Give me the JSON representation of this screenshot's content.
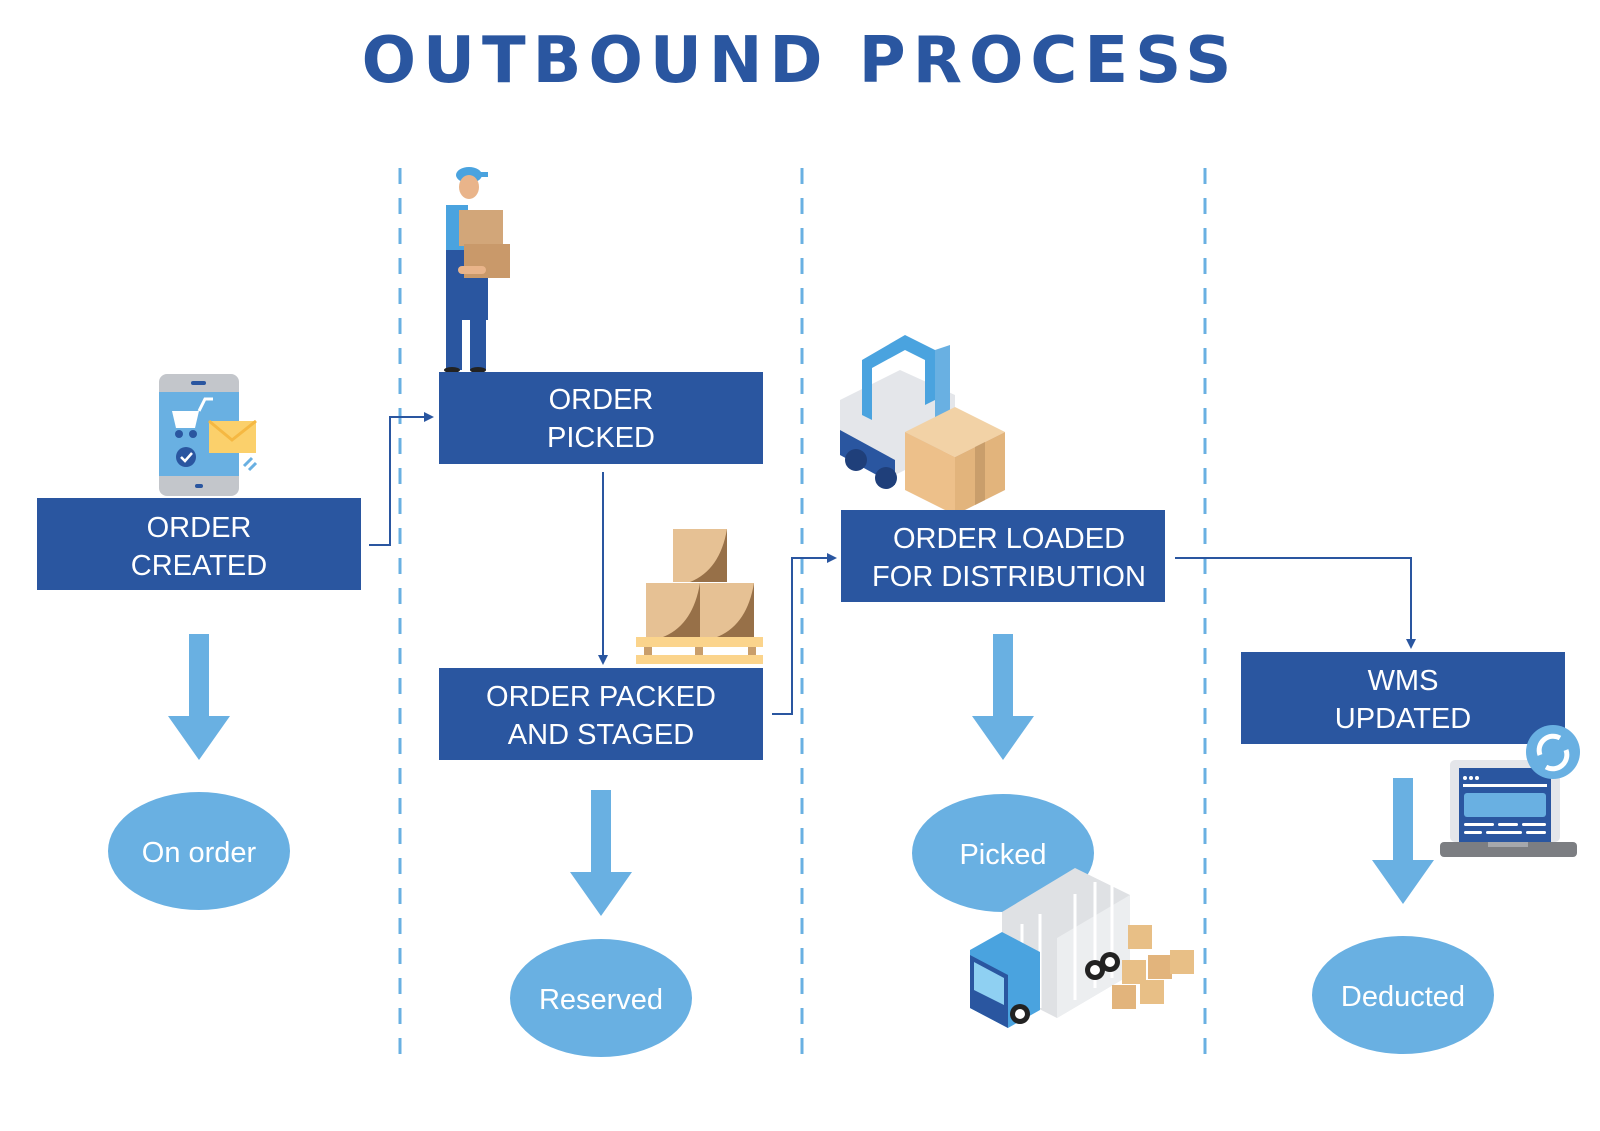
{
  "title": "OUTBOUND PROCESS",
  "colors": {
    "title": "#2a56a0",
    "box": "#2a56a0",
    "status_oval": "#69b0e2",
    "divider": "#69b0e2",
    "connector": "#2a56a0"
  },
  "steps": [
    {
      "id": "order-created",
      "lines": [
        "ORDER",
        "CREATED"
      ],
      "icon": "smartphone-cart-icon"
    },
    {
      "id": "order-picked",
      "lines": [
        "ORDER",
        "PICKED"
      ],
      "icon": "warehouse-worker-icon"
    },
    {
      "id": "order-packed",
      "lines": [
        "ORDER PACKED",
        "AND STAGED"
      ],
      "icon": "boxes-on-pallet-icon"
    },
    {
      "id": "order-loaded",
      "lines": [
        "ORDER LOADED",
        "FOR DISTRIBUTION"
      ],
      "icon": "forklift-icon"
    },
    {
      "id": "wms-updated",
      "lines": [
        "WMS",
        "UPDATED"
      ],
      "icon": "laptop-sync-icon"
    }
  ],
  "statuses": [
    {
      "label": "On order",
      "from_step": "order-created"
    },
    {
      "label": "Reserved",
      "from_step": "order-packed"
    },
    {
      "label": "Picked",
      "from_step": "order-loaded"
    },
    {
      "label": "Deducted",
      "from_step": "wms-updated"
    }
  ],
  "extra_icons": [
    "delivery-truck-icon"
  ]
}
